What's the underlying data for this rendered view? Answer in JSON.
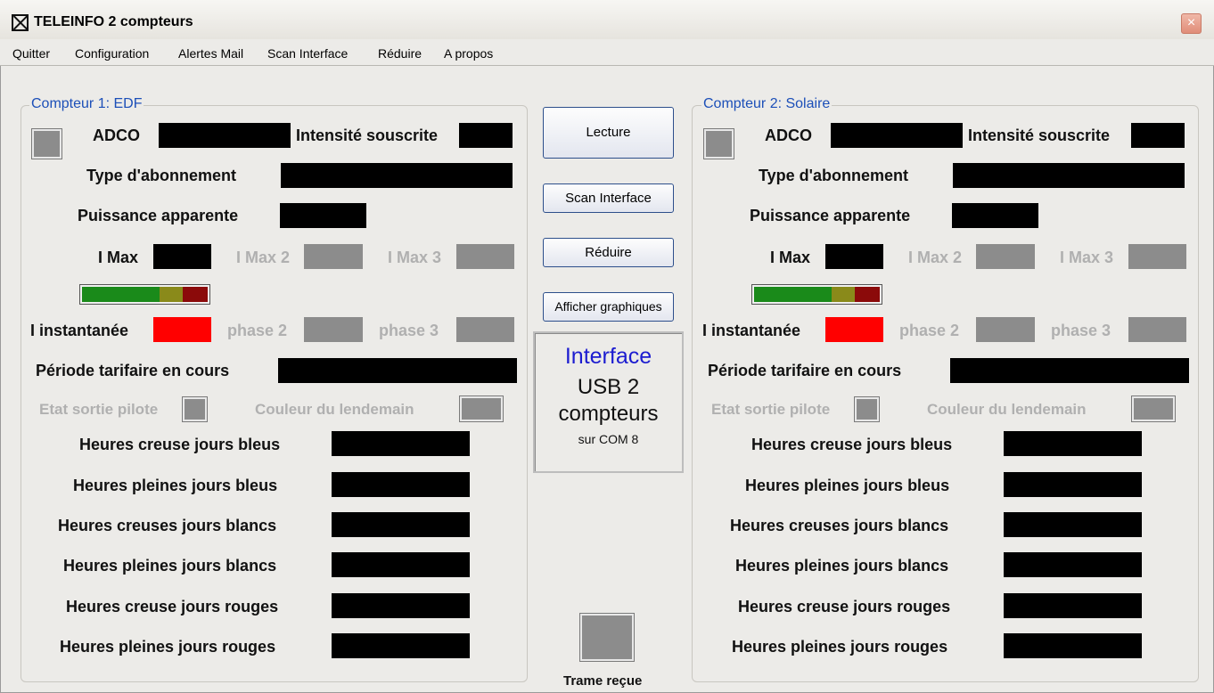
{
  "window": {
    "title": "TELEINFO 2 compteurs",
    "close_glyph": "×"
  },
  "menu": [
    "Quitter",
    "Configuration",
    "Alertes Mail",
    "Scan Interface",
    "Réduire",
    "A propos"
  ],
  "labels": {
    "adco": "ADCO",
    "intensite": "Intensité souscrite",
    "type_abonnement": "Type d'abonnement",
    "puissance": "Puissance apparente",
    "imax": "I Max",
    "imax2": "I Max 2",
    "imax3": "I Max 3",
    "iinst": "I instantanée",
    "phase2": "phase 2",
    "phase3": "phase 3",
    "periode": "Période tarifaire en cours",
    "etat_sortie": "Etat sortie pilote",
    "couleur_lendemain": "Couleur du lendemain",
    "hc_bleus": "Heures creuse jours bleus",
    "hp_bleus": "Heures pleines jours bleus",
    "hc_blancs": "Heures creuses jours blancs",
    "hp_blancs": "Heures pleines jours blancs",
    "hc_rouges": "Heures creuse jours rouges",
    "hp_rouges": "Heures pleines jours rouges"
  },
  "compteur1": {
    "title": "Compteur 1: EDF"
  },
  "compteur2": {
    "title": "Compteur 2: Solaire"
  },
  "buttons": {
    "lecture": "Lecture",
    "scan": "Scan Interface",
    "reduire": "Réduire",
    "graphiques": "Afficher graphiques"
  },
  "interface": {
    "line1": "Interface",
    "line2": "USB 2",
    "line3": "compteurs",
    "line4": "sur COM 8"
  },
  "trame": "Trame reçue",
  "colors": {
    "accent_blue": "#1c4fb8",
    "bar_green": "#1a8a1a",
    "bar_olive": "#8a8a1a",
    "bar_darkred": "#8b0a0a",
    "value_red": "#ff0000"
  }
}
